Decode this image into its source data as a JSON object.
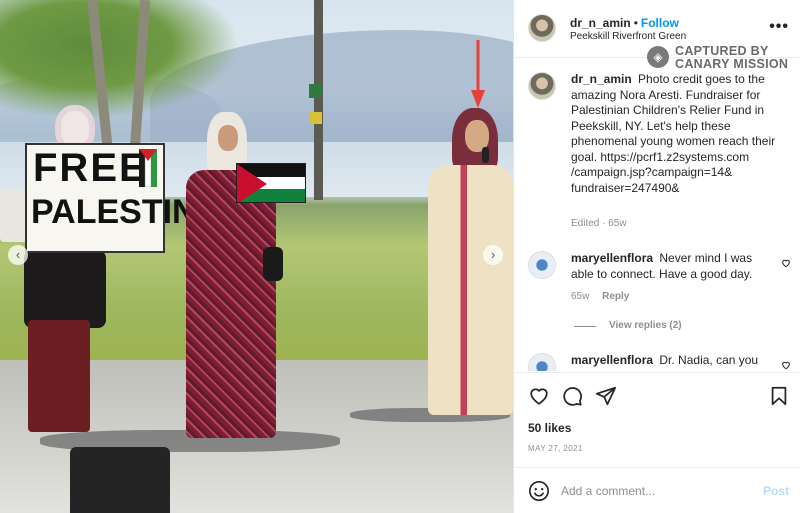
{
  "post": {
    "username": "dr_n_amin",
    "follow_label": "Follow",
    "location": "Peekskill Riverfront Green",
    "more_label": "•••"
  },
  "photo": {
    "sign_line1": "FREE",
    "sign_line2": "PALESTINE",
    "prev_label": "‹",
    "next_label": "›"
  },
  "watermark": {
    "line1": "CAPTURED BY",
    "line2": "CANARY MISSION"
  },
  "comments": [
    {
      "username": "dr_n_amin",
      "text": "Photo credit goes to the amazing Nora Aresti. Fundraiser for Palestinian Children's Relier Fund in Peekskill, NY. Let's help these phenomenal young women reach their goal. https://pcrf1.z2systems.com /campaign.jsp?campaign=14& fundraiser=247490&",
      "meta": "Edited · 65w"
    },
    {
      "username": "maryellenflora",
      "text": "Never mind I was able to connect. Have a good day.",
      "time": "65w",
      "reply_label": "Reply",
      "view_replies": "View replies (2)"
    },
    {
      "username": "maryellenflora",
      "text": "Dr. Nadia, can you"
    }
  ],
  "actions": {
    "likes": "50 likes",
    "date": "MAY 27, 2021"
  },
  "add_comment": {
    "placeholder": "Add a comment...",
    "post_label": "Post"
  },
  "colors": {
    "accent": "#0095f6",
    "post_disabled": "#b2dffc",
    "arrow": "#e8413a"
  }
}
